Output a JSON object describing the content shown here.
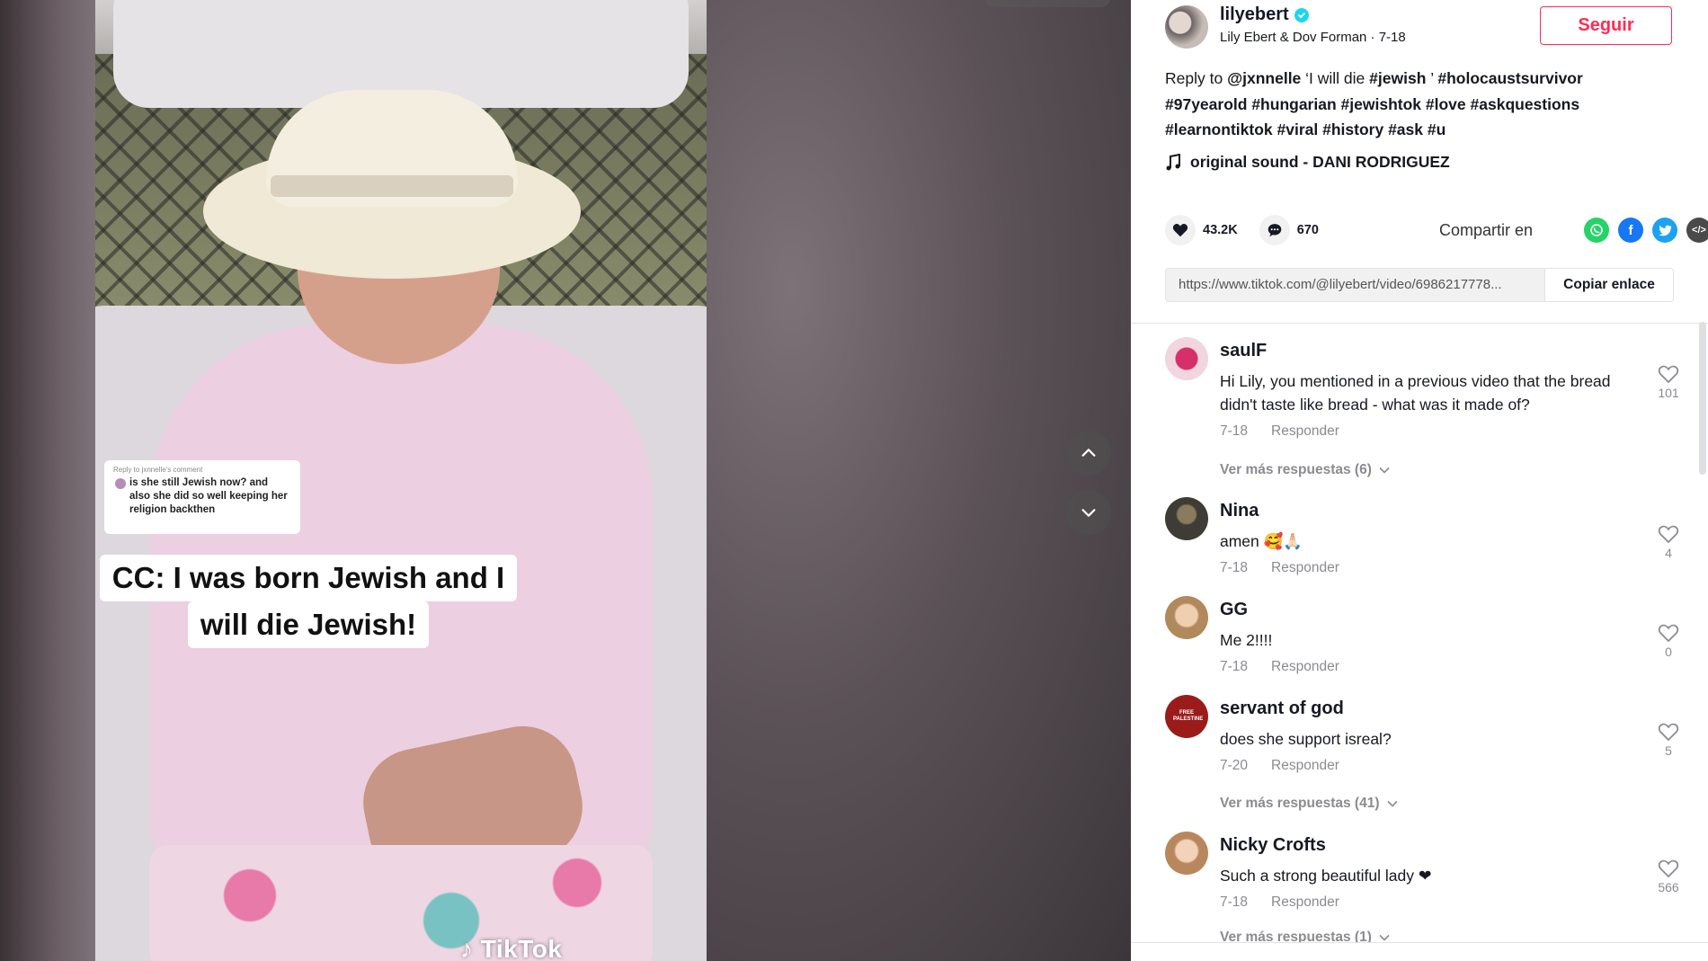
{
  "video": {
    "reply_sticker_small": "Reply to jxnnelle's comment",
    "reply_sticker_text": "is she still Jewish now? and also she did so well keeping her religion backthen",
    "caption_line1": "CC: I was born Jewish and I",
    "caption_line2": "will die Jewish!",
    "watermark": "TikTok"
  },
  "author": {
    "username": "lilyebert",
    "subtitle": "Lily Ebert & Dov Forman · 7-18",
    "follow_label": "Seguir"
  },
  "description": {
    "prefix": "Reply to ",
    "mention": "@jxnnelle",
    "quote": " ‘I will die ",
    "tags": [
      "#jewish",
      " ’ ",
      "#holocaustsurvivor",
      "#97yearold",
      "#hungarian",
      "#jewishtok",
      "#love",
      "#askquestions",
      "#learnontiktok",
      "#viral",
      "#history",
      "#ask",
      "#u"
    ]
  },
  "music": {
    "title": "original sound - DANI RODRIGUEZ",
    "icon": "music-note-icon"
  },
  "stats": {
    "likes": "43.2K",
    "comments": "670",
    "share_label": "Compartir en",
    "share_icons": [
      "whatsapp-icon",
      "facebook-icon",
      "twitter-icon",
      "embed-icon"
    ],
    "colors": {
      "whatsapp": "#25d366",
      "facebook": "#1877f2",
      "twitter": "#1da1f2",
      "embed": "#4a4a4a",
      "brand": "#fe2c55"
    }
  },
  "link": {
    "url": "https://www.tiktok.com/@lilyebert/video/6986217778...",
    "copy_label": "Copiar enlace"
  },
  "comments": [
    {
      "name": "saulF",
      "text": "Hi Lily, you mentioned in a previous video that the bread didn't taste like bread - what was it made of?",
      "date": "7-18",
      "reply": "Responder",
      "likes": "101",
      "more": "Ver más respuestas (6)",
      "avatar_color": "#e05a8a"
    },
    {
      "name": "Nina",
      "text": "amen 🥰🙏🏻",
      "date": "7-18",
      "reply": "Responder",
      "likes": "4",
      "more": "",
      "avatar_color": "#4d4a40"
    },
    {
      "name": "GG",
      "text": "Me 2!!!!",
      "date": "7-18",
      "reply": "Responder",
      "likes": "0",
      "more": "",
      "avatar_color": "#c8a27a"
    },
    {
      "name": "servant of god",
      "text": "does she support isreal?",
      "date": "7-20",
      "reply": "Responder",
      "likes": "5",
      "more": "Ver más respuestas (41)",
      "avatar_color": "#9b1b1b",
      "avatar_text": "FREE PALESTINE"
    },
    {
      "name": "Nicky Crofts",
      "text": "Such a strong beautiful lady ❤",
      "date": "7-18",
      "reply": "Responder",
      "likes": "566",
      "more": "Ver más respuestas (1)",
      "avatar_color": "#c49a72"
    }
  ]
}
